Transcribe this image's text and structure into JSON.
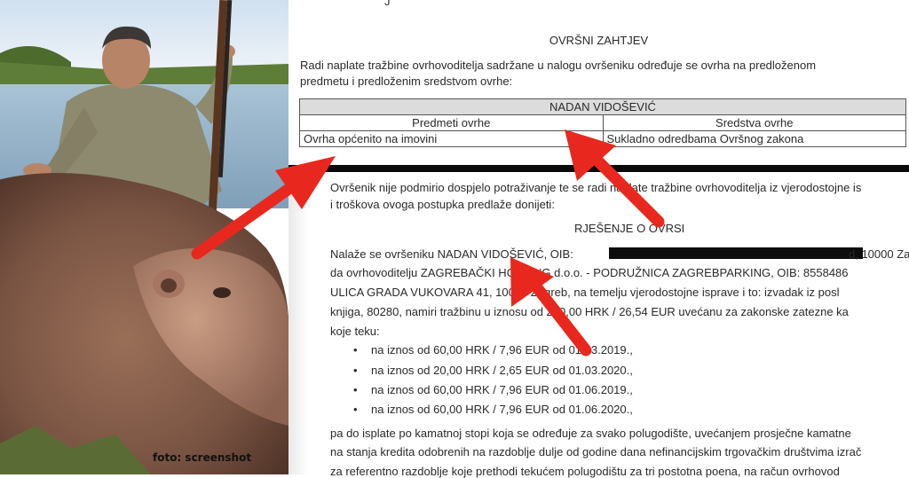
{
  "photo": {
    "credit": "foto: screenshot"
  },
  "doc": {
    "page_top_fragment": "J",
    "section_title": "OVRŠNI ZAHTJEV",
    "intro_line1": "Radi naplate tražbine ovrhovoditelja sadržane u nalogu ovršeniku određuje se ovrha na predloženom",
    "intro_line2": "predmetu i predloženim sredstvom ovrhe:",
    "table": {
      "debtor": "NADAN VIDOŠEVIĆ",
      "col1_header": "Predmeti ovrhe",
      "col2_header": "Sredstva ovrhe",
      "col1_value": "Ovrha općenito na imovini",
      "col2_value": "Sukladno odredbama Ovršnog zakona"
    },
    "para_line1": "Ovršenik nije podmirio dospjelo potraživanje te se radi naplate tražbine ovrhovoditelja iz vjerodostojne is",
    "para_line2": "i troškova ovoga postupka predlaže donijeti:",
    "decision_title": "RJEŠENJE O OVRSI",
    "body_line1a": "Nalaže se ovršeniku NADAN VIDOŠEVIĆ, OIB:",
    "body_line1b": "d, 10000 Za",
    "body_line2": "da ovrhovoditelju ZAGREBAČKI HOLDING d.o.o. - PODRUŽNICA ZAGREBPARKING, OIB: 8558486",
    "body_line3": "ULICA GRADA VUKOVARA 41, 10000 Zagreb, na temelju vjerodostojne isprave i to: izvadak iz posl",
    "body_line4": "knjiga, 80280, namiri tražbinu u iznosu od 200,00 HRK / 26,54 EUR uvećanu za zakonske zatezne ka",
    "body_line5": "koje teku:",
    "bullets": [
      "na iznos od 60,00 HRK / 7,96 EUR od 01.03.2019.,",
      "na iznos od 20,00 HRK / 2,65 EUR od 01.03.2020.,",
      "na iznos od 60,00 HRK / 7,96 EUR od 01.06.2019.,",
      "na iznos od 60,00 HRK / 7,96 EUR od 01.06.2020.,"
    ],
    "tail_line1": "pa do isplate po kamatnoj stopi koja se određuje za svako polugodište, uvećanjem prosječne kamatne",
    "tail_line2": "na stanja kredita odobrenih na razdoblje dulje od godine dana nefinancijskim trgovačkim društvima izrač",
    "tail_line3": "za referentno razdoblje koje prethodi tekućem polugodištu za tri postotna poena, na račun ovrhovod"
  },
  "colors": {
    "arrow": "#e8281e",
    "redaction": "#0c0c0c",
    "table_header_bg": "#dcdcdc"
  }
}
